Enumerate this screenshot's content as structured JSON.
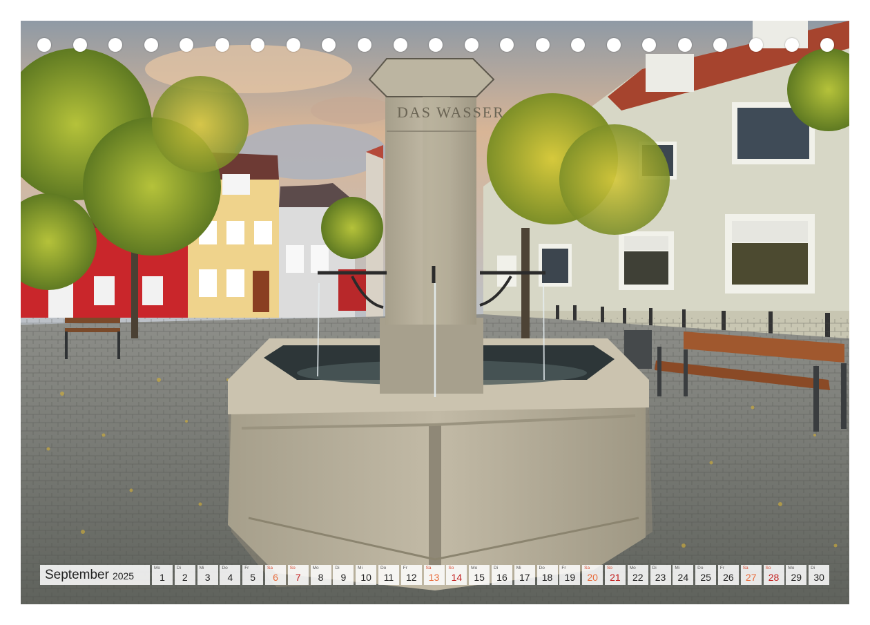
{
  "calendar": {
    "month": "September",
    "year": "2025",
    "days": [
      {
        "wd": "Mo",
        "num": "1",
        "type": "weekday"
      },
      {
        "wd": "Di",
        "num": "2",
        "type": "weekday"
      },
      {
        "wd": "Mi",
        "num": "3",
        "type": "weekday"
      },
      {
        "wd": "Do",
        "num": "4",
        "type": "weekday"
      },
      {
        "wd": "Fr",
        "num": "5",
        "type": "weekday"
      },
      {
        "wd": "Sa",
        "num": "6",
        "type": "sat"
      },
      {
        "wd": "So",
        "num": "7",
        "type": "sun"
      },
      {
        "wd": "Mo",
        "num": "8",
        "type": "weekday"
      },
      {
        "wd": "Di",
        "num": "9",
        "type": "weekday"
      },
      {
        "wd": "Mi",
        "num": "10",
        "type": "weekday"
      },
      {
        "wd": "Do",
        "num": "11",
        "type": "weekday"
      },
      {
        "wd": "Fr",
        "num": "12",
        "type": "weekday"
      },
      {
        "wd": "Sa",
        "num": "13",
        "type": "sat"
      },
      {
        "wd": "So",
        "num": "14",
        "type": "sun"
      },
      {
        "wd": "Mo",
        "num": "15",
        "type": "weekday"
      },
      {
        "wd": "Di",
        "num": "16",
        "type": "weekday"
      },
      {
        "wd": "Mi",
        "num": "17",
        "type": "weekday"
      },
      {
        "wd": "Do",
        "num": "18",
        "type": "weekday"
      },
      {
        "wd": "Fr",
        "num": "19",
        "type": "weekday"
      },
      {
        "wd": "Sa",
        "num": "20",
        "type": "sat"
      },
      {
        "wd": "So",
        "num": "21",
        "type": "sun"
      },
      {
        "wd": "Mo",
        "num": "22",
        "type": "weekday"
      },
      {
        "wd": "Di",
        "num": "23",
        "type": "weekday"
      },
      {
        "wd": "Mi",
        "num": "24",
        "type": "weekday"
      },
      {
        "wd": "Do",
        "num": "25",
        "type": "weekday"
      },
      {
        "wd": "Fr",
        "num": "26",
        "type": "weekday"
      },
      {
        "wd": "Sa",
        "num": "27",
        "type": "sat"
      },
      {
        "wd": "So",
        "num": "28",
        "type": "sun"
      },
      {
        "wd": "Mo",
        "num": "29",
        "type": "weekday"
      },
      {
        "wd": "Di",
        "num": "30",
        "type": "weekday"
      }
    ]
  },
  "colors": {
    "saturday": "#e86a3a",
    "sunday": "#c21d1d",
    "cell_background": "#ffffff",
    "sky": "#b9c3cc",
    "cobblestone": "#7a7c74",
    "fountain_stone": "#b5ad99"
  },
  "photo": {
    "fountain_inscription": "DAS WASSER"
  }
}
